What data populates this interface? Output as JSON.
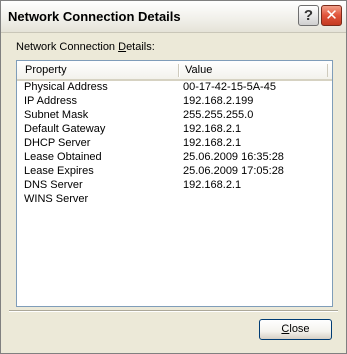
{
  "window": {
    "title": "Network Connection Details",
    "help_label": "?",
    "close_glyph": "✕"
  },
  "section_label": {
    "before": "Network Connection ",
    "underlined": "D",
    "after": "etails:"
  },
  "listview": {
    "columns": [
      "Property",
      "Value"
    ],
    "rows": [
      {
        "property": "Physical Address",
        "value": "00-17-42-15-5A-45"
      },
      {
        "property": "IP Address",
        "value": "192.168.2.199"
      },
      {
        "property": "Subnet Mask",
        "value": "255.255.255.0"
      },
      {
        "property": "Default Gateway",
        "value": "192.168.2.1"
      },
      {
        "property": "DHCP Server",
        "value": "192.168.2.1"
      },
      {
        "property": "Lease Obtained",
        "value": "25.06.2009 16:35:28"
      },
      {
        "property": "Lease Expires",
        "value": "25.06.2009 17:05:28"
      },
      {
        "property": "DNS Server",
        "value": "192.168.2.1"
      },
      {
        "property": "WINS Server",
        "value": ""
      }
    ]
  },
  "footer": {
    "close_underlined": "C",
    "close_rest": "lose"
  },
  "icons": {
    "help": "question-mark-icon",
    "close": "close-x-icon"
  },
  "colors": {
    "close_title_button": "#e0533a",
    "list_border": "#7f9db9",
    "dialog_background": "#ece9d8"
  }
}
